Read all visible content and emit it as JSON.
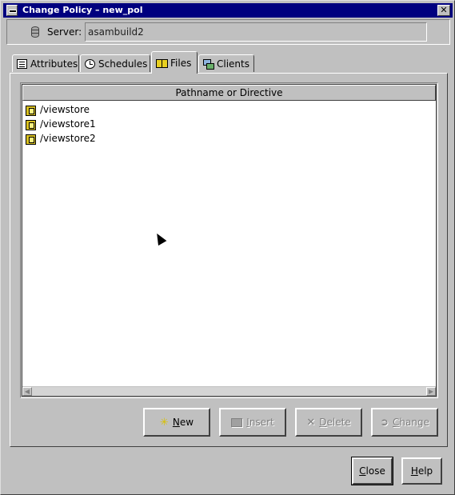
{
  "window": {
    "title": "Change Policy – new_pol",
    "close_glyph": "✕"
  },
  "server": {
    "label": "Server:",
    "value": "asambuild2",
    "icon": "server-icon"
  },
  "tabs": [
    {
      "label": "Attributes",
      "icon": "attributes-icon",
      "active": false
    },
    {
      "label": "Schedules",
      "icon": "schedules-icon",
      "active": false
    },
    {
      "label": "Files",
      "icon": "files-icon",
      "active": true
    },
    {
      "label": "Clients",
      "icon": "clients-icon",
      "active": false
    }
  ],
  "files_list": {
    "column_header": "Pathname or Directive",
    "items": [
      "/viewstore",
      "/viewstore1",
      "/viewstore2"
    ]
  },
  "actions": {
    "new_mnemonic": "N",
    "new_rest": "ew",
    "insert_mnemonic": "I",
    "insert_rest": "nsert",
    "delete_mnemonic": "D",
    "delete_rest": "elete",
    "change_mnemonic": "C",
    "change_rest": "hange"
  },
  "footer": {
    "close_mnemonic": "C",
    "close_rest": "lose",
    "help_mnemonic": "H",
    "help_rest": "elp"
  }
}
